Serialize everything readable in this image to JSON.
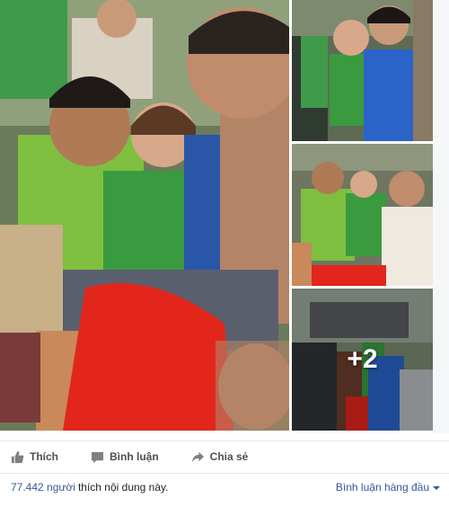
{
  "post": {
    "photos": {
      "main_alt": "",
      "more_count": "+2"
    },
    "actions": {
      "like_label": "Thích",
      "comment_label": "Bình luận",
      "share_label": "Chia sẻ",
      "like_icon": "thumbs-up-icon",
      "comment_icon": "speech-bubble-icon",
      "share_icon": "share-arrow-icon"
    },
    "likes": {
      "count": "77.442 người",
      "text": "thích nội dung này."
    },
    "comments_sort": {
      "label": "Bình luận hàng đầu"
    }
  },
  "colors": {
    "link": "#365899",
    "action_text": "#4b4f56",
    "divider": "#e5e5e5"
  }
}
